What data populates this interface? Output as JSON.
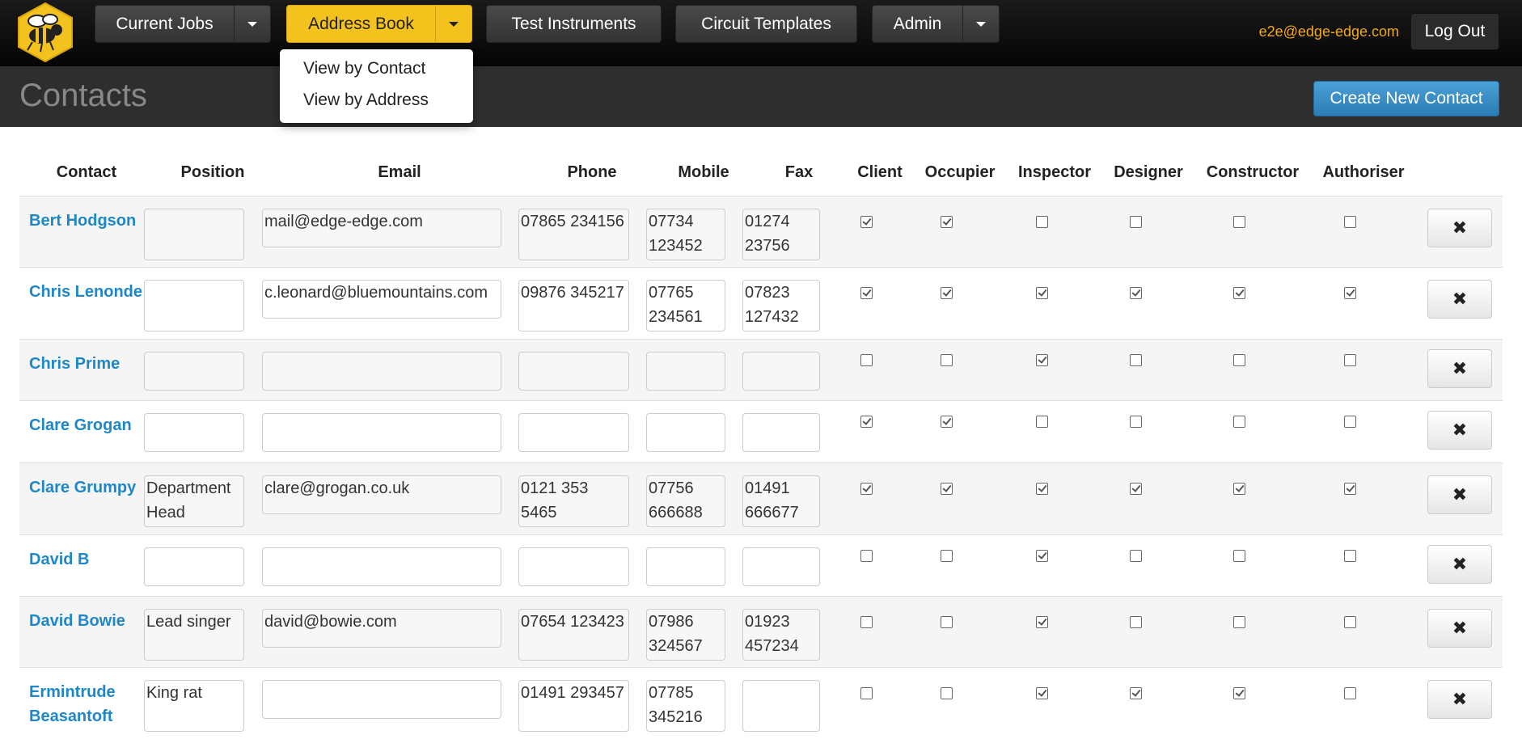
{
  "nav": {
    "items": [
      {
        "label": "Current Jobs",
        "has_caret": true
      },
      {
        "label": "Address Book",
        "has_caret": true,
        "active": true
      },
      {
        "label": "Test Instruments",
        "has_caret": false
      },
      {
        "label": "Circuit Templates",
        "has_caret": false
      },
      {
        "label": "Admin",
        "has_caret": true
      }
    ],
    "user_email": "e2e@edge-edge.com",
    "logout_label": "Log Out"
  },
  "dropdown": {
    "items": [
      "View by Contact",
      "View by Address"
    ]
  },
  "page": {
    "title": "Contacts",
    "create_label": "Create New Contact"
  },
  "table": {
    "headers": [
      "Contact",
      "Position",
      "Email",
      "Phone",
      "Mobile",
      "Fax",
      "Client",
      "Occupier",
      "Inspector",
      "Designer",
      "Constructor",
      "Authoriser"
    ],
    "delete_icon": "✖",
    "rows": [
      {
        "name": "Bert Hodgson",
        "position": "",
        "email": "mail@edge-edge.com",
        "phone": "07865 234156",
        "mobile": "07734 123452",
        "fax": "01274 23756",
        "roles": [
          true,
          true,
          false,
          false,
          false,
          false
        ]
      },
      {
        "name": "Chris Lenonde",
        "position": "",
        "email": "c.leonard@bluemountains.com",
        "phone": "09876 345217",
        "mobile": "07765 234561",
        "fax": "07823 127432",
        "roles": [
          true,
          true,
          true,
          true,
          true,
          true
        ]
      },
      {
        "name": "Chris Prime",
        "position": "",
        "email": "",
        "phone": "",
        "mobile": "",
        "fax": "",
        "roles": [
          false,
          false,
          true,
          false,
          false,
          false
        ]
      },
      {
        "name": "Clare Grogan",
        "position": "",
        "email": "",
        "phone": "",
        "mobile": "",
        "fax": "",
        "roles": [
          true,
          true,
          false,
          false,
          false,
          false
        ]
      },
      {
        "name": "Clare Grumpy",
        "position": "Department Head",
        "email": "clare@grogan.co.uk",
        "phone": "0121 353 5465",
        "mobile": "07756 666688",
        "fax": "01491 666677",
        "roles": [
          true,
          true,
          true,
          true,
          true,
          true
        ]
      },
      {
        "name": "David B",
        "position": "",
        "email": "",
        "phone": "",
        "mobile": "",
        "fax": "",
        "roles": [
          false,
          false,
          true,
          false,
          false,
          false
        ]
      },
      {
        "name": "David Bowie",
        "position": "Lead singer",
        "email": "david@bowie.com",
        "phone": "07654 123423",
        "mobile": "07986 324567",
        "fax": "01923 457234",
        "roles": [
          false,
          false,
          true,
          false,
          false,
          false
        ]
      },
      {
        "name": "Ermintrude Beasantoft",
        "position": "King rat",
        "email": "",
        "phone": "01491 293457",
        "mobile": "07785 345216",
        "fax": "",
        "roles": [
          false,
          false,
          true,
          true,
          true,
          false
        ]
      }
    ]
  }
}
